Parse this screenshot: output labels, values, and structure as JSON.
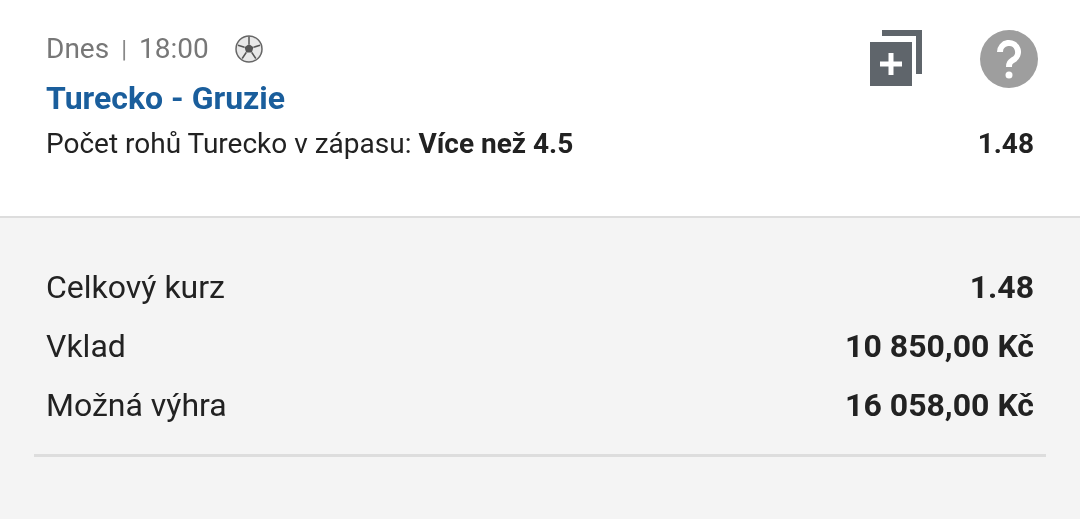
{
  "bet": {
    "day": "Dnes",
    "separator": "|",
    "time": "18:00",
    "match": "Turecko - Gruzie",
    "selection": "Počet rohů Turecko v zápasu: **Více než 4.5**",
    "odds": "1.48"
  },
  "summary": [
    {
      "label": "Celkový kurz",
      "value": "1.48"
    },
    {
      "label": "Vklad",
      "value": "10 850,00 Kč"
    },
    {
      "label": "Možná výhra",
      "value": "16 058,00 Kč"
    }
  ]
}
